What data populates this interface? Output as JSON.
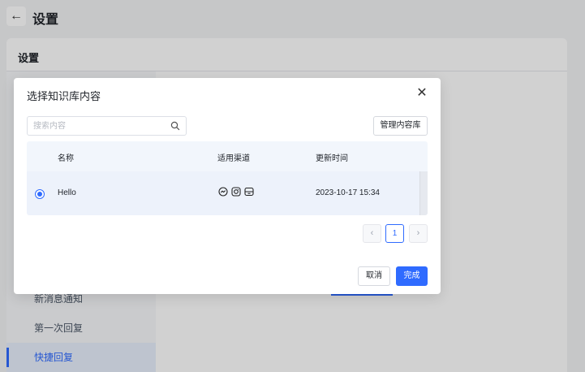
{
  "app": {
    "title": "设置",
    "card_title": "设置",
    "sidebar": [
      {
        "label": "新消息通知",
        "active": false
      },
      {
        "label": "第一次回复",
        "active": false
      },
      {
        "label": "快捷回复",
        "active": true
      }
    ]
  },
  "modal": {
    "title": "选择知识库内容",
    "close_icon": "close-icon",
    "search": {
      "placeholder": "搜索内容",
      "value": ""
    },
    "manage_button": "管理内容库",
    "table": {
      "headers": [
        "名称",
        "适用渠道",
        "更新时间"
      ],
      "rows": [
        {
          "selected": true,
          "name": "Hello",
          "channels": [
            "messenger-icon",
            "instagram-icon",
            "inbox-icon"
          ],
          "updated": "2023-10-17 15:34"
        }
      ]
    },
    "pagination": {
      "prev_icon": "chevron-left-icon",
      "current_page": "1",
      "next_icon": "chevron-right-icon"
    },
    "cancel_button": "取消",
    "done_button": "完成"
  },
  "colors": {
    "accent": "#2f6bff",
    "header_bg": "#f2f6fc",
    "selected_row_bg": "#edf2fb"
  }
}
